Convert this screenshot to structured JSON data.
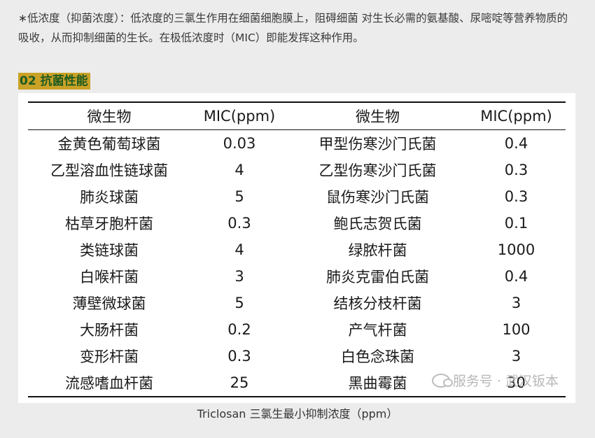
{
  "intro_text": "∗低浓度（抑菌浓度）：低浓度的三氯生作用在细菌细胞膜上，阻碍细菌 对生长必需的氨基酸、尿嘧啶等营养物质的吸收，从而抑制细菌的生长。在极低浓度时（MIC）即能发挥这种作用。",
  "section_heading": "02  抗菌性能",
  "table": {
    "headers": [
      "微生物",
      "MIC(ppm)",
      "微生物",
      "MIC(ppm)"
    ],
    "rows": [
      [
        "金黄色葡萄球菌",
        "0.03",
        "甲型伤寒沙门氏菌",
        "0.4"
      ],
      [
        "乙型溶血性链球菌",
        "4",
        "乙型伤寒沙门氏菌",
        "0.3"
      ],
      [
        "肺炎球菌",
        "5",
        "鼠伤寒沙门氏菌",
        "0.3"
      ],
      [
        "枯草牙胞杆菌",
        "0.3",
        "鲍氏志贺氏菌",
        "0.1"
      ],
      [
        "类链球菌",
        "4",
        "绿脓杆菌",
        "1000"
      ],
      [
        "白喉杆菌",
        "3",
        "肺炎克雷伯氏菌",
        "0.4"
      ],
      [
        "薄壁微球菌",
        "5",
        "结核分枝杆菌",
        "3"
      ],
      [
        "大肠杆菌",
        "0.2",
        "产气杆菌",
        "100"
      ],
      [
        "变形杆菌",
        "0.3",
        "白色念珠菌",
        "3"
      ],
      [
        "流感嗜血杆菌",
        "25",
        "黑曲霉菌",
        "30"
      ]
    ]
  },
  "watermark": "服务号 · 武汉钣本",
  "caption": "Triclosan 三氯生最小抑制浓度（ppm）",
  "colors": {
    "heading_bg": "#c9a227",
    "heading_text": "#1f5a1f",
    "page_bg": "#ececec"
  }
}
